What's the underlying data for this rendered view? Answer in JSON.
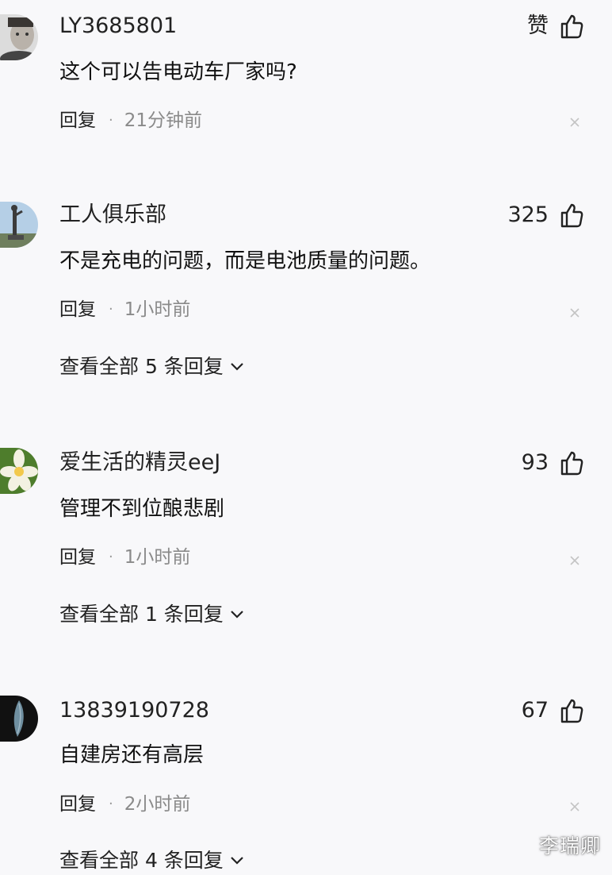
{
  "labels": {
    "reply": "回复",
    "separator": "·"
  },
  "comments": [
    {
      "username": "LY3685801",
      "likes": "赞",
      "text": "这个可以告电动车厂家吗?",
      "time": "21分钟前",
      "avatar": "man-portrait-avatar"
    },
    {
      "username": "工人俱乐部",
      "likes": "325",
      "text": "不是充电的问题，而是电池质量的问题。",
      "time": "1小时前",
      "replies": "查看全部 5 条回复",
      "avatar": "statue-avatar"
    },
    {
      "username": "爱生活的精灵eeJ",
      "likes": "93",
      "text": "管理不到位酿悲剧",
      "time": "1小时前",
      "replies": "查看全部 1 条回复",
      "avatar": "flower-avatar"
    },
    {
      "username": "13839190728",
      "likes": "67",
      "text": "自建房还有高层",
      "time": "2小时前",
      "replies": "查看全部 4 条回复",
      "avatar": "dark-leaf-avatar"
    }
  ],
  "watermark": "李瑞卿",
  "colors": {
    "background": "#f8f8fa",
    "text": "#222222",
    "secondary": "#8a8a8a"
  }
}
